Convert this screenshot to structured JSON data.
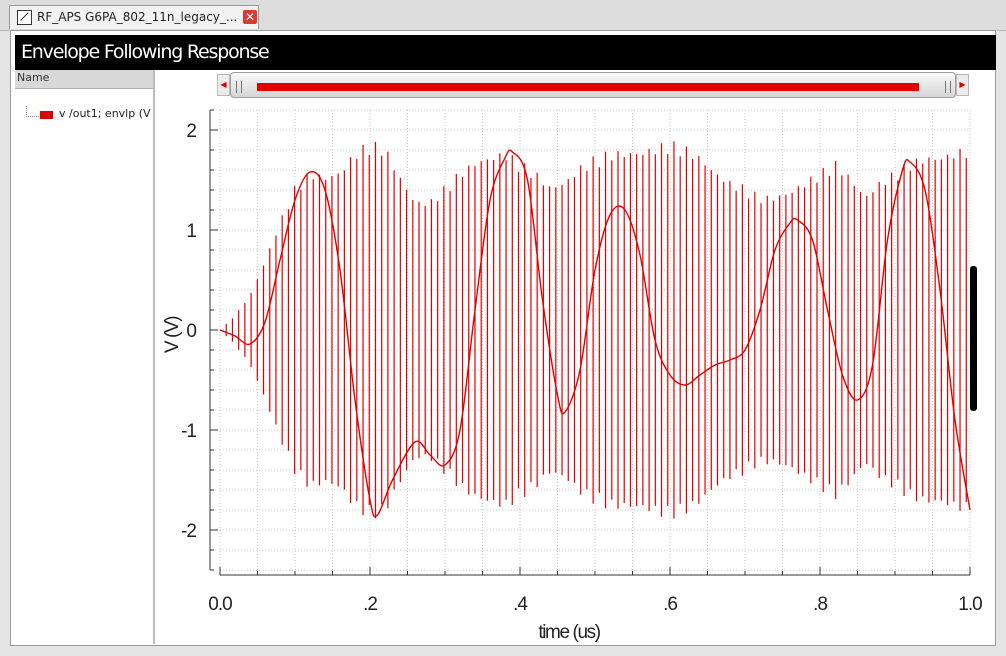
{
  "tab": {
    "label": "RF_APS G6PA_802_11n_legacy_..."
  },
  "header": {
    "title": "Envelope Following Response"
  },
  "legend": {
    "column_header": "Name",
    "entries": [
      {
        "label": "v /out1; envlp (V"
      }
    ]
  },
  "colors": {
    "trace": "#e00000",
    "grid": "#c8c8c8"
  },
  "chart_data": {
    "type": "line",
    "title": "Envelope Following Response",
    "xlabel": "time (us)",
    "ylabel": "V (V)",
    "xlim": [
      0,
      1.0
    ],
    "ylim": [
      -2.4,
      2.2
    ],
    "x_ticks": [
      0,
      0.2,
      0.4,
      0.6,
      0.8,
      1.0
    ],
    "x_tick_labels": [
      "0.0",
      ".2",
      ".4",
      ".6",
      ".8",
      "1.0"
    ],
    "y_ticks": [
      2,
      1,
      0,
      -1,
      -2
    ],
    "y_tick_labels": [
      "2",
      "1",
      "0",
      "-1",
      "-2"
    ],
    "grid": true,
    "legend_position": "left-panel",
    "series": [
      {
        "name": "v /out1; envlp (V",
        "x": [
          0.0,
          0.02,
          0.04,
          0.06,
          0.08,
          0.1,
          0.12,
          0.14,
          0.16,
          0.18,
          0.2,
          0.21,
          0.23,
          0.26,
          0.28,
          0.3,
          0.32,
          0.34,
          0.36,
          0.38,
          0.39,
          0.41,
          0.43,
          0.45,
          0.46,
          0.48,
          0.5,
          0.52,
          0.54,
          0.56,
          0.58,
          0.6,
          0.62,
          0.64,
          0.66,
          0.68,
          0.7,
          0.72,
          0.74,
          0.76,
          0.77,
          0.79,
          0.81,
          0.83,
          0.85,
          0.87,
          0.89,
          0.91,
          0.92,
          0.94,
          0.96,
          0.98,
          1.0
        ],
        "y": [
          0.0,
          -0.06,
          -0.14,
          0.08,
          0.7,
          1.3,
          1.58,
          1.4,
          0.6,
          -0.7,
          -1.7,
          -1.85,
          -1.5,
          -1.12,
          -1.25,
          -1.35,
          -1.0,
          0.2,
          1.3,
          1.72,
          1.78,
          1.5,
          0.3,
          -0.65,
          -0.82,
          -0.4,
          0.6,
          1.15,
          1.2,
          0.75,
          -0.1,
          -0.45,
          -0.55,
          -0.45,
          -0.35,
          -0.3,
          -0.2,
          0.2,
          0.8,
          1.07,
          1.1,
          0.9,
          0.2,
          -0.45,
          -0.7,
          -0.35,
          0.9,
          1.6,
          1.68,
          1.4,
          0.4,
          -0.9,
          -1.8
        ]
      }
    ],
    "carrier_envelope": {
      "x": [
        0.0,
        0.02,
        0.04,
        0.06,
        0.08,
        0.1,
        0.12,
        0.14,
        0.16,
        0.18,
        0.2,
        0.22,
        0.24,
        0.26,
        0.28,
        0.3,
        0.32,
        0.34,
        0.36,
        0.38,
        0.4,
        0.42,
        0.44,
        0.46,
        0.48,
        0.5,
        0.52,
        0.54,
        0.56,
        0.58,
        0.6,
        0.62,
        0.64,
        0.66,
        0.68,
        0.7,
        0.72,
        0.74,
        0.76,
        0.78,
        0.8,
        0.82,
        0.84,
        0.86,
        0.88,
        0.9,
        0.92,
        0.94,
        0.96,
        0.98,
        1.0
      ],
      "amplitude": [
        0.0,
        0.15,
        0.35,
        0.7,
        1.1,
        1.45,
        1.6,
        1.55,
        1.6,
        1.8,
        1.9,
        1.85,
        1.55,
        1.3,
        1.3,
        1.45,
        1.6,
        1.7,
        1.75,
        1.8,
        1.7,
        1.6,
        1.45,
        1.5,
        1.65,
        1.75,
        1.8,
        1.8,
        1.8,
        1.85,
        1.9,
        1.85,
        1.75,
        1.6,
        1.5,
        1.45,
        1.35,
        1.35,
        1.4,
        1.5,
        1.6,
        1.7,
        1.55,
        1.35,
        1.5,
        1.6,
        1.7,
        1.75,
        1.75,
        1.8,
        1.85
      ],
      "cycles": 120
    }
  }
}
